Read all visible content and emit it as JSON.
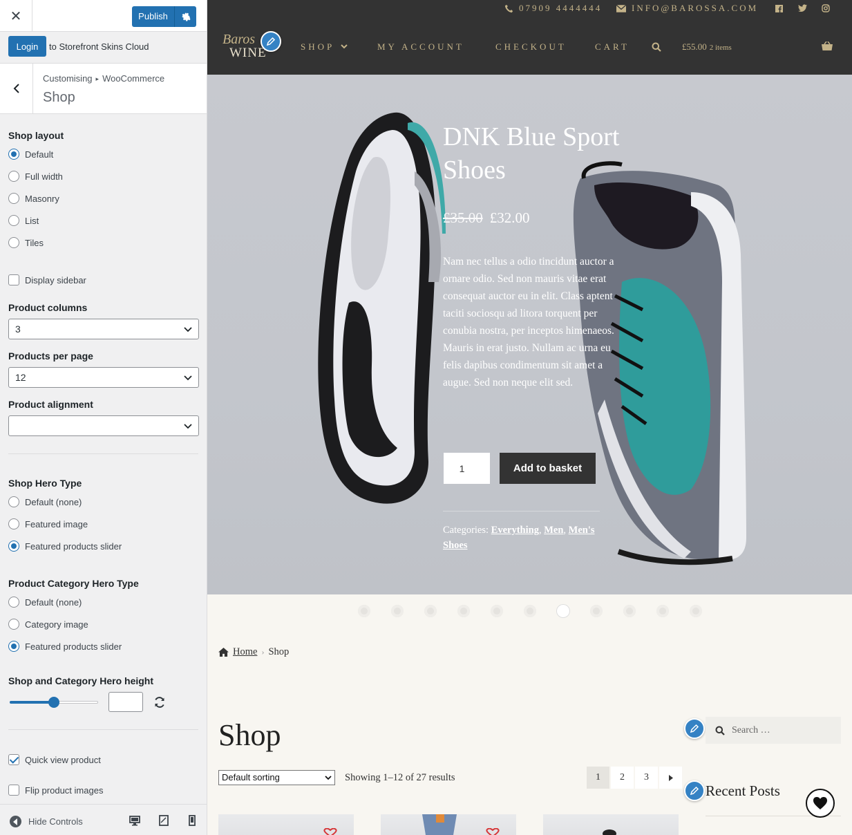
{
  "customizer": {
    "close_icon": "close-icon",
    "publish_label": "Publish",
    "login_label": "Login",
    "login_text": "to Storefront Skins Cloud",
    "breadcrumb": [
      "Customising",
      "WooCommerce"
    ],
    "section_title": "Shop",
    "shop_layout": {
      "label": "Shop layout",
      "options": [
        "Default",
        "Full width",
        "Masonry",
        "List",
        "Tiles"
      ],
      "selected": "Default"
    },
    "display_sidebar": {
      "label": "Display sidebar",
      "checked": false
    },
    "product_columns": {
      "label": "Product columns",
      "value": "3"
    },
    "products_per_page": {
      "label": "Products per page",
      "value": "12"
    },
    "product_alignment": {
      "label": "Product alignment",
      "value": ""
    },
    "shop_hero_type": {
      "label": "Shop Hero Type",
      "options": [
        "Default (none)",
        "Featured image",
        "Featured products slider"
      ],
      "selected": "Featured products slider"
    },
    "category_hero_type": {
      "label": "Product Category Hero Type",
      "options": [
        "Default (none)",
        "Category image",
        "Featured products slider"
      ],
      "selected": "Featured products slider"
    },
    "hero_height": {
      "label": "Shop and Category Hero height",
      "slider_fraction": 0.5,
      "value": ""
    },
    "quick_view": {
      "label": "Quick view product",
      "checked": true
    },
    "flip_images": {
      "label": "Flip product images",
      "checked": false
    },
    "hide_controls_label": "Hide Controls",
    "devices": [
      "desktop-icon",
      "tablet-icon",
      "mobile-icon"
    ]
  },
  "site": {
    "phone": "07909 4444444",
    "email": "INFO@BAROSSA.COM",
    "social": [
      "facebook-icon",
      "twitter-icon",
      "instagram-icon"
    ],
    "logo_line1": "Baros",
    "logo_line2": "WINE",
    "nav": [
      "SHOP",
      "MY ACCOUNT",
      "CHECKOUT",
      "CART"
    ],
    "cart_total": "£55.00",
    "cart_items": "2 items"
  },
  "hero": {
    "title": "DNK Blue Sport Shoes",
    "old_price": "£35.00",
    "price": "£32.00",
    "description": "Nam nec tellus a odio tincidunt auctor a ornare odio. Sed non mauris vitae erat consequat auctor eu in elit. Class aptent taciti sociosqu ad litora torquent per conubia nostra, per inceptos himenaeos. Mauris in erat justo. Nullam ac urna eu felis dapibus condimentum sit amet a augue. Sed non neque elit sed.",
    "quantity": "1",
    "add_to_basket": "Add to basket",
    "categories_label": "Categories:",
    "categories": [
      "Everything",
      "Men",
      "Men's Shoes"
    ],
    "slides": 11,
    "active_slide": 7
  },
  "shop": {
    "breadcrumb_home": "Home",
    "breadcrumb_current": "Shop",
    "title": "Shop",
    "sorting": "Default sorting",
    "result_count": "Showing 1–12 of 27 results",
    "pages": [
      "1",
      "2",
      "3"
    ],
    "current_page": "1",
    "search_placeholder": "Search …",
    "recent_posts_title": "Recent Posts"
  },
  "colors": {
    "wp_blue": "#2271b1",
    "header_bg": "#333333",
    "gold": "#c4b389",
    "page_bg": "#f8f6f1"
  }
}
